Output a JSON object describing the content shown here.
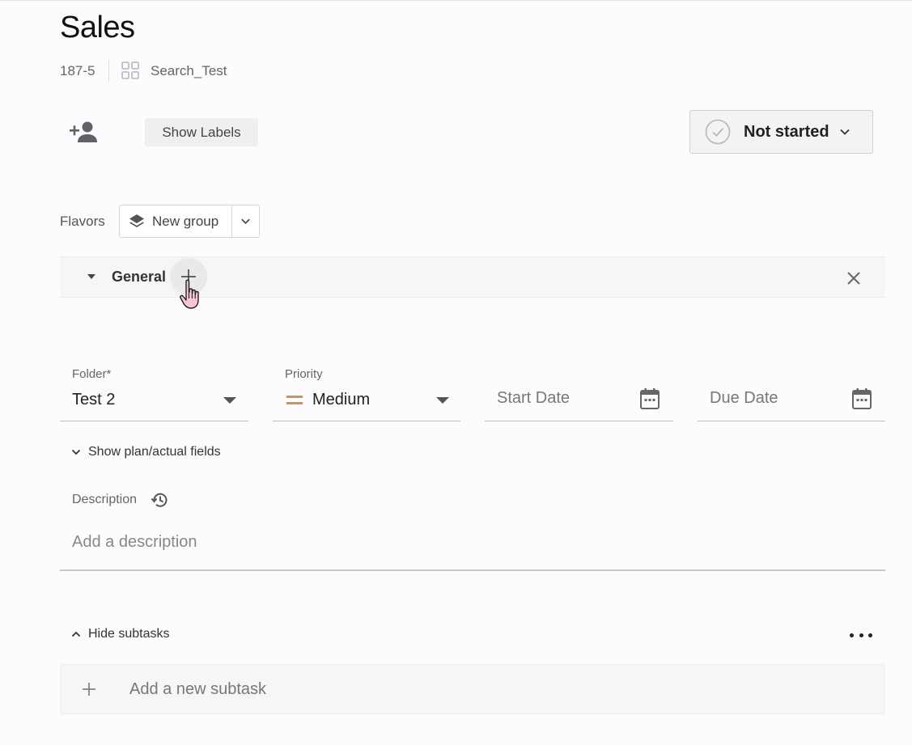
{
  "header": {
    "title": "Sales",
    "task_id": "187-5",
    "project": "Search_Test"
  },
  "toolbar": {
    "assign_icon": "person-add-icon",
    "show_labels": "Show Labels",
    "status": "Not started"
  },
  "flavors": {
    "label": "Flavors",
    "group_button": "New group"
  },
  "section": {
    "title": "General"
  },
  "fields": {
    "folder": {
      "label": "Folder*",
      "value": "Test 2"
    },
    "priority": {
      "label": "Priority",
      "value": "Medium",
      "color": "#b99a6a"
    },
    "start_date": {
      "placeholder": "Start Date"
    },
    "due_date": {
      "placeholder": "Due Date"
    }
  },
  "plan_toggle": "Show plan/actual fields",
  "description": {
    "label": "Description",
    "placeholder": "Add a description"
  },
  "subtasks": {
    "toggle": "Hide subtasks",
    "add_placeholder": "Add a new subtask"
  },
  "colors": {
    "background": "#fdfbfd",
    "section_bg": "#f6f6f8",
    "icon_gray": "#5f6368"
  }
}
